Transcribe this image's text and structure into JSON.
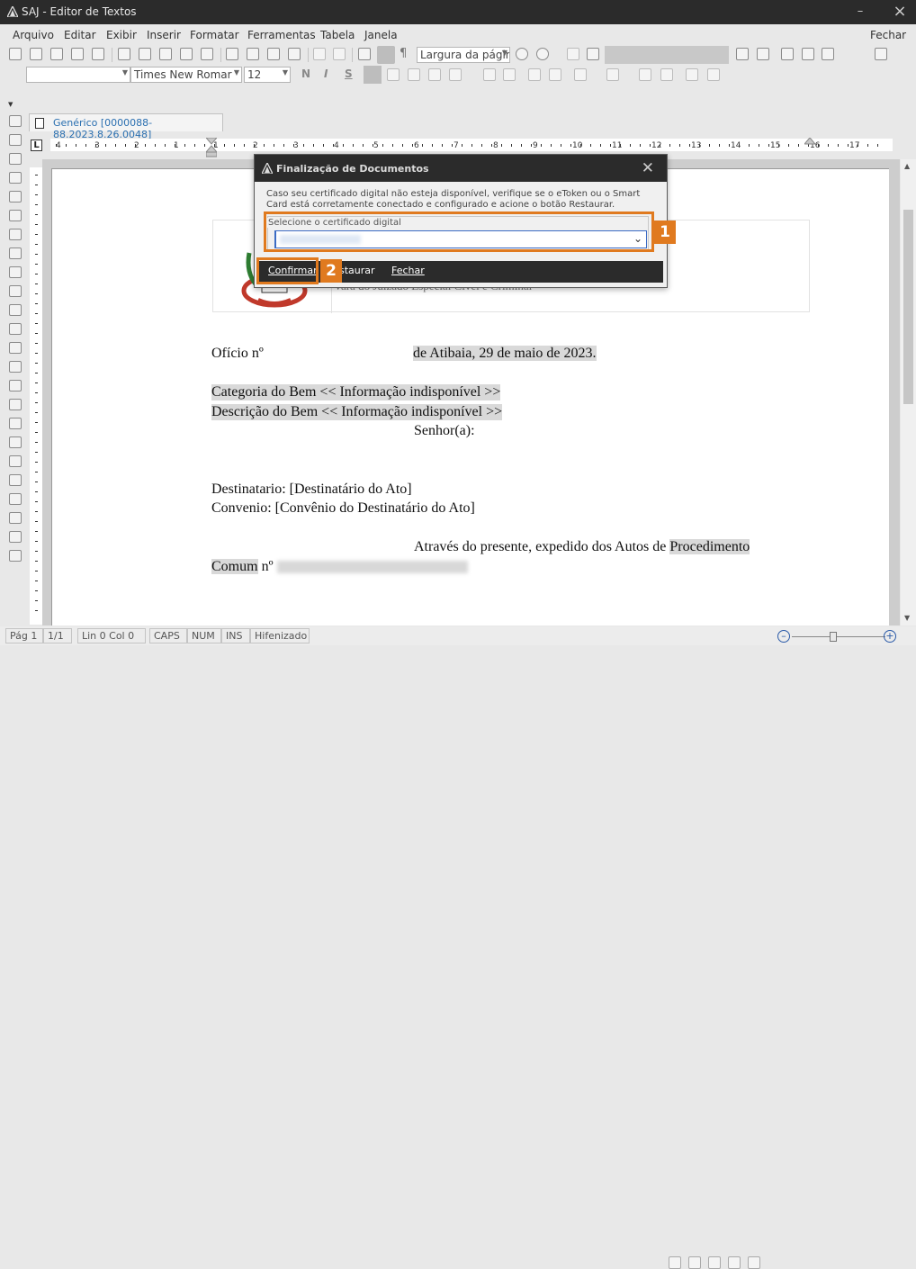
{
  "app": {
    "title": "SAJ - Editor de Textos",
    "close_all": "Fechar"
  },
  "menu": [
    "Arquivo",
    "Editar",
    "Exibir",
    "Inserir",
    "Formatar",
    "Ferramentas",
    "Tabela",
    "Janela"
  ],
  "toolbar": {
    "view_mode": "Largura da págin",
    "font": "Times New Romar",
    "size": "12",
    "bold": "N",
    "italic": "I",
    "underline": "S"
  },
  "doc_tab": "Genérico [0000088-88.2023.8.26.0048]",
  "ruler_numbers": [
    "4",
    "3",
    "2",
    "1",
    "1",
    "2",
    "3",
    "4",
    "5",
    "6",
    "7",
    "8",
    "9",
    "10",
    "11",
    "12",
    "13",
    "14",
    "15",
    "16",
    "17"
  ],
  "document": {
    "oficio": "Ofício nº",
    "city_date": "de Atibaia, 29 de maio de 2023.",
    "period": ".",
    "categoria": "Categoria do Bem << Informação indisponível >>",
    "descricao": "Descrição do Bem << Informação indisponível >>",
    "senhor": "Senhor(a):",
    "destinatario": "Destinatario: [Destinatário do Ato]",
    "convenio": "Convenio: [Convênio do Destinatário do Ato]",
    "atraves": "Através do presente, expedido dos Autos de",
    "procedimento": "Procedimento",
    "comum": "Comum",
    "comum_n": " nº",
    "header_partial": "Vara do Juizado Especial Cível e Criminal"
  },
  "dialog": {
    "title": "Finalização de Documentos",
    "message": "Caso seu certificado digital não esteja disponível, verifique se o eToken ou o Smart Card está corretamente conectado e configurado e acione o botão Restaurar.",
    "cert_label": "Selecione o certificado digital",
    "buttons": {
      "confirm": "Confirmar",
      "restore": "staurar",
      "close": "Fechar"
    }
  },
  "callouts": [
    "1",
    "2"
  ],
  "status": {
    "page": "Pág 1",
    "pages": "1/1",
    "position": "Lin 0  Col 0",
    "caps": "CAPS",
    "num": "NUM",
    "ins": "INS",
    "hyphen": "Hifenizado"
  },
  "colors": {
    "titlebar": "#2b2b2b",
    "accent": "#e07a1f",
    "link": "#2a6fb0"
  }
}
